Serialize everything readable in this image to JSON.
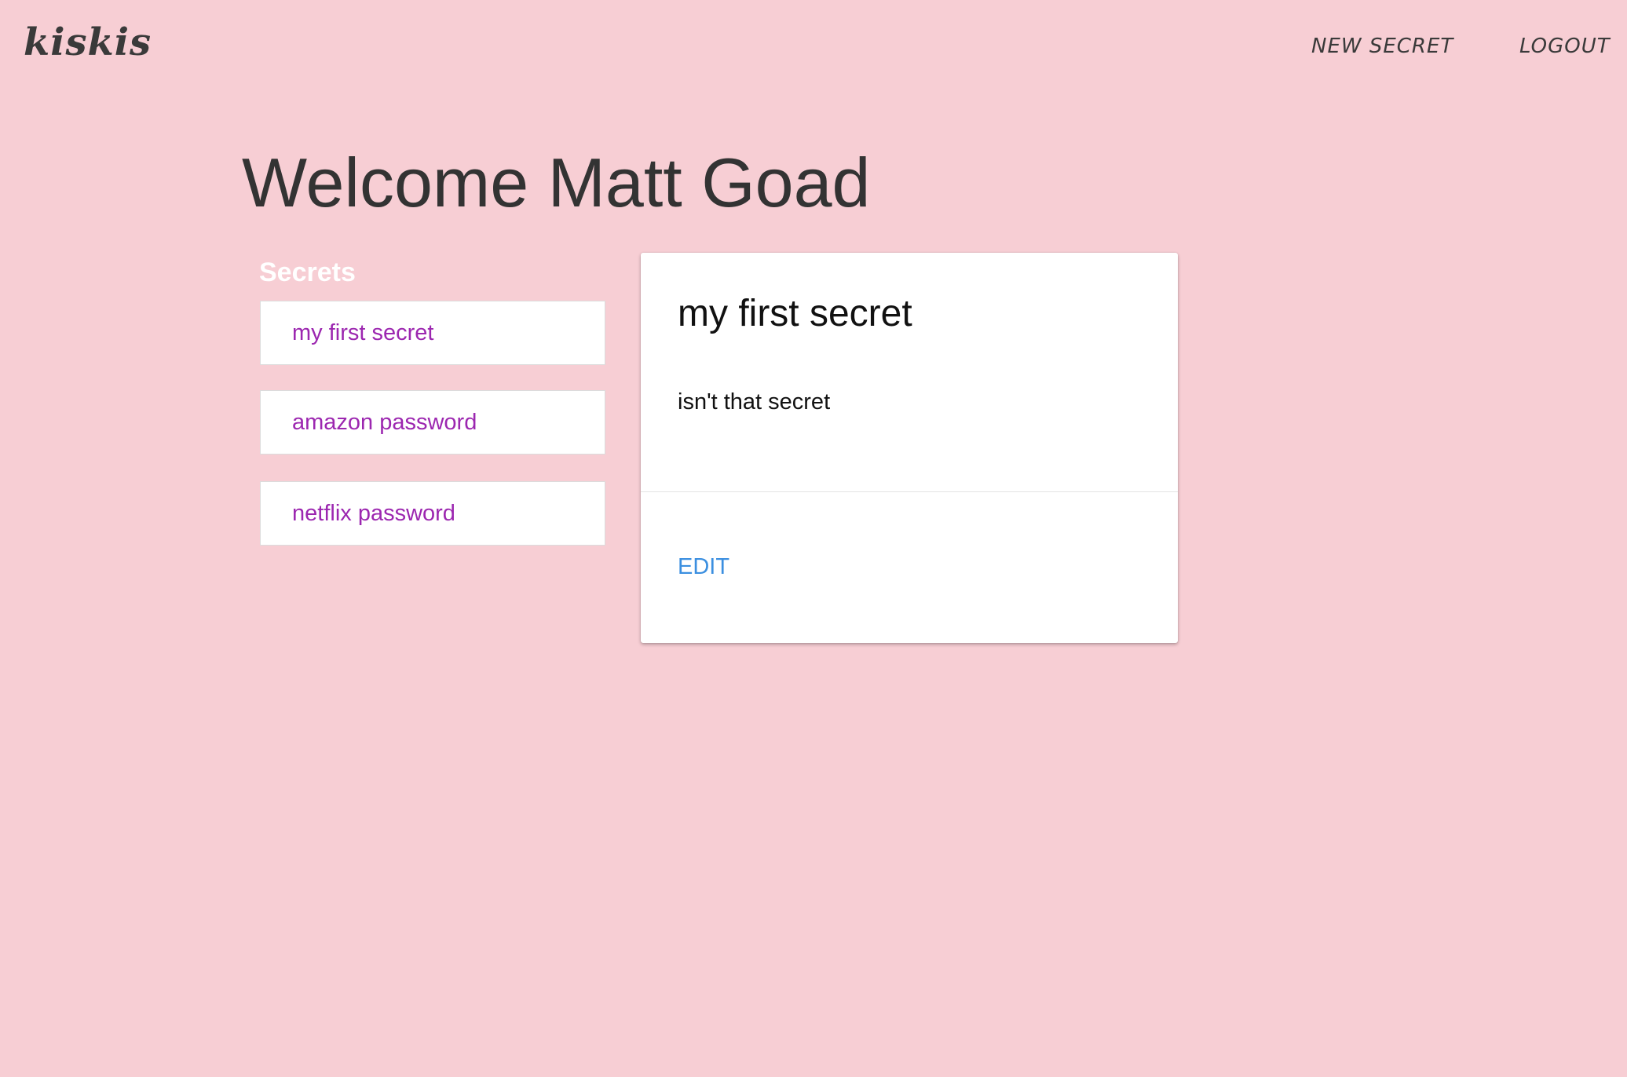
{
  "header": {
    "logo": "kiskis",
    "nav": {
      "new_secret": "NEW SECRET",
      "logout": "LOGOUT"
    }
  },
  "main": {
    "welcome": "Welcome Matt Goad",
    "secrets_heading": "Secrets",
    "secrets": [
      {
        "label": "my first secret"
      },
      {
        "label": "amazon password"
      },
      {
        "label": "netflix password"
      }
    ],
    "selected": {
      "title": "my first secret",
      "body": "isn't that secret",
      "edit_label": "EDIT"
    }
  },
  "colors": {
    "background": "#f7ced4",
    "link_purple": "#9c27b0",
    "action_blue": "#3b8fe0",
    "heading_text": "#333333"
  }
}
